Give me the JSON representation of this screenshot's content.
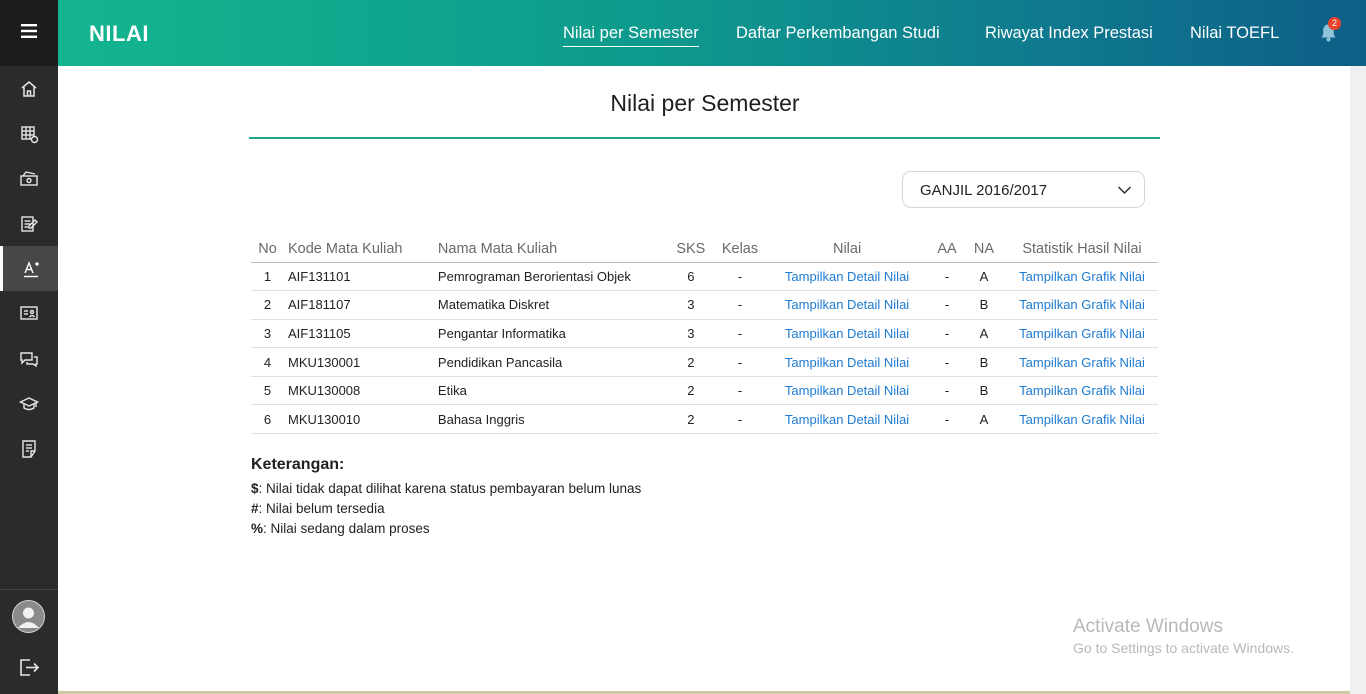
{
  "header": {
    "title": "NILAI",
    "nav": [
      {
        "label": "Nilai per Semester",
        "active": true
      },
      {
        "label": "Daftar Perkembangan Studi",
        "active": false
      },
      {
        "label": "Riwayat Index Prestasi",
        "active": false
      },
      {
        "label": "Nilai TOEFL",
        "active": false
      }
    ],
    "notification_count": "2",
    "gradient_colors": [
      "#13b58f",
      "#0d5f86"
    ]
  },
  "sidebar": {
    "menu_icon": "hamburger-icon",
    "items": [
      {
        "icon": "home-icon",
        "active": false
      },
      {
        "icon": "calendar-grid-icon",
        "active": false
      },
      {
        "icon": "payment-icon",
        "active": false
      },
      {
        "icon": "edit-document-icon",
        "active": false
      },
      {
        "icon": "grade-icon",
        "active": true
      },
      {
        "icon": "presentation-icon",
        "active": false
      },
      {
        "icon": "chat-icon",
        "active": false
      },
      {
        "icon": "graduation-cap-icon",
        "active": false
      },
      {
        "icon": "checklist-icon",
        "active": false
      }
    ],
    "bottom": [
      "avatar",
      "logout-icon"
    ]
  },
  "main": {
    "title": "Nilai per Semester",
    "semester_select": {
      "value": "GANJIL 2016/2017"
    },
    "table": {
      "headers": [
        "No",
        "Kode Mata Kuliah",
        "Nama Mata Kuliah",
        "SKS",
        "Kelas",
        "Nilai",
        "AA",
        "NA",
        "Statistik Hasil Nilai"
      ],
      "rows": [
        {
          "no": "1",
          "kode": "AIF131101",
          "nama": "Pemrograman Berorientasi Objek",
          "sks": "6",
          "kelas": "-",
          "nilai": "Tampilkan Detail Nilai",
          "aa": "-",
          "na": "A",
          "stat": "Tampilkan Grafik Nilai"
        },
        {
          "no": "2",
          "kode": "AIF181107",
          "nama": "Matematika Diskret",
          "sks": "3",
          "kelas": "-",
          "nilai": "Tampilkan Detail Nilai",
          "aa": "-",
          "na": "B",
          "stat": "Tampilkan Grafik Nilai"
        },
        {
          "no": "3",
          "kode": "AIF131105",
          "nama": "Pengantar Informatika",
          "sks": "3",
          "kelas": "-",
          "nilai": "Tampilkan Detail Nilai",
          "aa": "-",
          "na": "A",
          "stat": "Tampilkan Grafik Nilai"
        },
        {
          "no": "4",
          "kode": "MKU130001",
          "nama": "Pendidikan Pancasila",
          "sks": "2",
          "kelas": "-",
          "nilai": "Tampilkan Detail Nilai",
          "aa": "-",
          "na": "B",
          "stat": "Tampilkan Grafik Nilai"
        },
        {
          "no": "5",
          "kode": "MKU130008",
          "nama": "Etika",
          "sks": "2",
          "kelas": "-",
          "nilai": "Tampilkan Detail Nilai",
          "aa": "-",
          "na": "B",
          "stat": "Tampilkan Grafik Nilai"
        },
        {
          "no": "6",
          "kode": "MKU130010",
          "nama": "Bahasa Inggris",
          "sks": "2",
          "kelas": "-",
          "nilai": "Tampilkan Detail Nilai",
          "aa": "-",
          "na": "A",
          "stat": "Tampilkan Grafik Nilai"
        }
      ]
    },
    "keterangan": {
      "title": "Keterangan:",
      "items": [
        {
          "symbol": "$",
          "text": ": Nilai tidak dapat dilihat karena status pembayaran belum lunas"
        },
        {
          "symbol": "#",
          "text": ": Nilai belum tersedia"
        },
        {
          "symbol": "%",
          "text": ": Nilai sedang dalam proses"
        }
      ]
    }
  },
  "watermark": {
    "line1": "Activate Windows",
    "line2": "Go to Settings to activate Windows."
  },
  "colors": {
    "accent": "#25a594",
    "link": "#1e7bd1",
    "sidebar": "#2b2b2b",
    "badge": "#e8442c"
  }
}
